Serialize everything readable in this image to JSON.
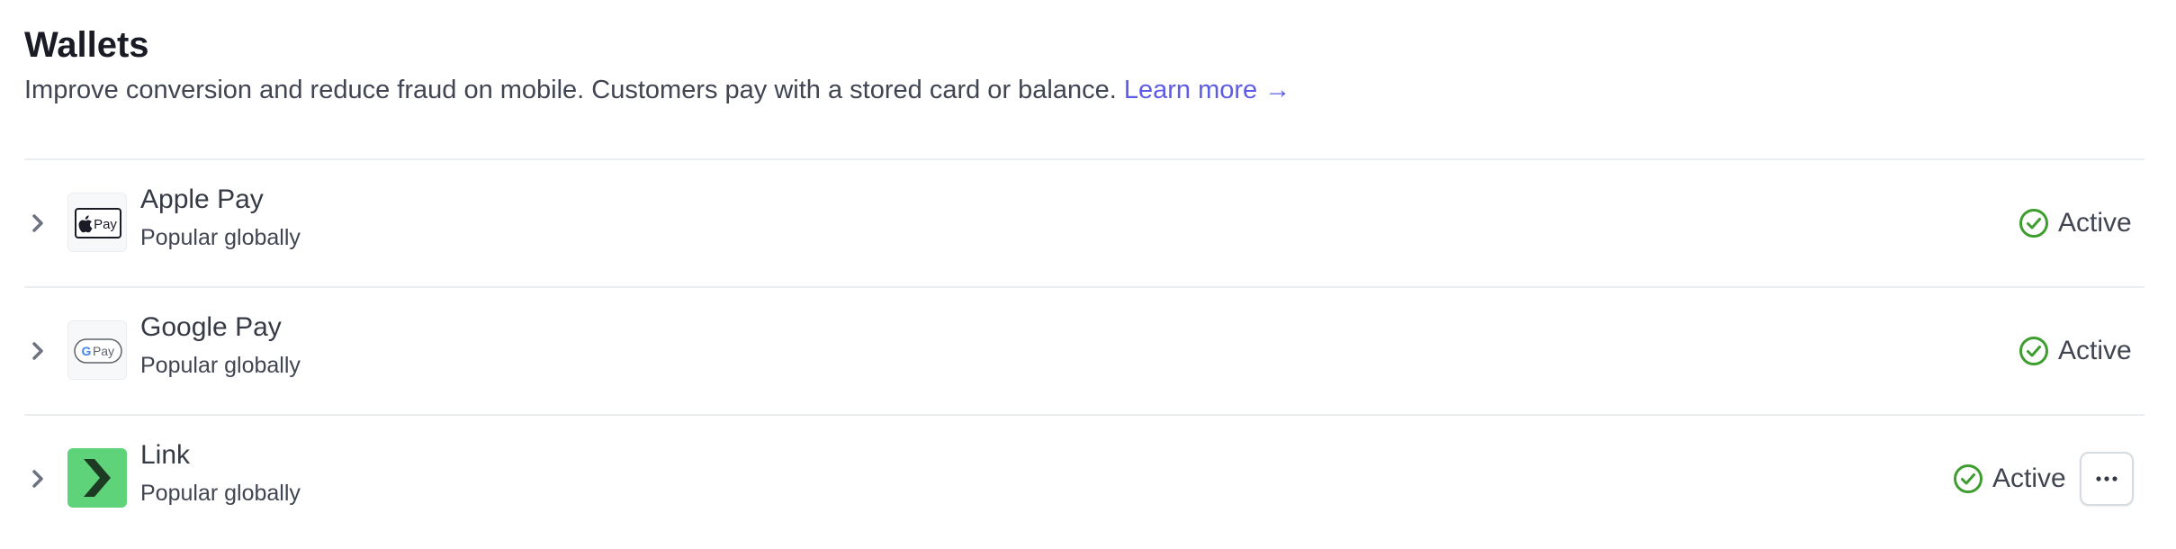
{
  "section": {
    "title": "Wallets",
    "description": "Improve conversion and reduce fraud on mobile. Customers pay with a stored card or balance.",
    "learn_more": "Learn more →"
  },
  "wallets": [
    {
      "name": "Apple Pay",
      "subtitle": "Popular globally",
      "status": "Active",
      "logo_icon": "apple-pay-logo-icon"
    },
    {
      "name": "Google Pay",
      "subtitle": "Popular globally",
      "status": "Active",
      "logo_icon": "google-pay-logo-icon"
    },
    {
      "name": "Link",
      "subtitle": "Popular globally",
      "status": "Active",
      "logo_icon": "link-logo-icon"
    }
  ],
  "colors": {
    "accent": "#5e5ce6",
    "active_green": "#3d9e2f",
    "link_green": "#5fd37a"
  }
}
